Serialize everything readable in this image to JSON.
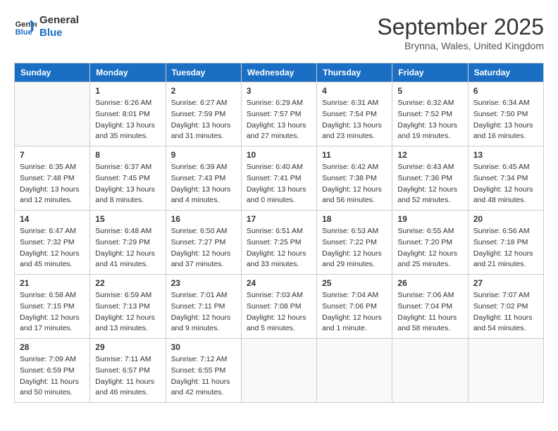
{
  "header": {
    "logo_line1": "General",
    "logo_line2": "Blue",
    "month": "September 2025",
    "location": "Brynna, Wales, United Kingdom"
  },
  "days_of_week": [
    "Sunday",
    "Monday",
    "Tuesday",
    "Wednesday",
    "Thursday",
    "Friday",
    "Saturday"
  ],
  "weeks": [
    [
      {
        "day": "",
        "info": ""
      },
      {
        "day": "1",
        "info": "Sunrise: 6:26 AM\nSunset: 8:01 PM\nDaylight: 13 hours\nand 35 minutes."
      },
      {
        "day": "2",
        "info": "Sunrise: 6:27 AM\nSunset: 7:59 PM\nDaylight: 13 hours\nand 31 minutes."
      },
      {
        "day": "3",
        "info": "Sunrise: 6:29 AM\nSunset: 7:57 PM\nDaylight: 13 hours\nand 27 minutes."
      },
      {
        "day": "4",
        "info": "Sunrise: 6:31 AM\nSunset: 7:54 PM\nDaylight: 13 hours\nand 23 minutes."
      },
      {
        "day": "5",
        "info": "Sunrise: 6:32 AM\nSunset: 7:52 PM\nDaylight: 13 hours\nand 19 minutes."
      },
      {
        "day": "6",
        "info": "Sunrise: 6:34 AM\nSunset: 7:50 PM\nDaylight: 13 hours\nand 16 minutes."
      }
    ],
    [
      {
        "day": "7",
        "info": "Sunrise: 6:35 AM\nSunset: 7:48 PM\nDaylight: 13 hours\nand 12 minutes."
      },
      {
        "day": "8",
        "info": "Sunrise: 6:37 AM\nSunset: 7:45 PM\nDaylight: 13 hours\nand 8 minutes."
      },
      {
        "day": "9",
        "info": "Sunrise: 6:39 AM\nSunset: 7:43 PM\nDaylight: 13 hours\nand 4 minutes."
      },
      {
        "day": "10",
        "info": "Sunrise: 6:40 AM\nSunset: 7:41 PM\nDaylight: 13 hours\nand 0 minutes."
      },
      {
        "day": "11",
        "info": "Sunrise: 6:42 AM\nSunset: 7:38 PM\nDaylight: 12 hours\nand 56 minutes."
      },
      {
        "day": "12",
        "info": "Sunrise: 6:43 AM\nSunset: 7:36 PM\nDaylight: 12 hours\nand 52 minutes."
      },
      {
        "day": "13",
        "info": "Sunrise: 6:45 AM\nSunset: 7:34 PM\nDaylight: 12 hours\nand 48 minutes."
      }
    ],
    [
      {
        "day": "14",
        "info": "Sunrise: 6:47 AM\nSunset: 7:32 PM\nDaylight: 12 hours\nand 45 minutes."
      },
      {
        "day": "15",
        "info": "Sunrise: 6:48 AM\nSunset: 7:29 PM\nDaylight: 12 hours\nand 41 minutes."
      },
      {
        "day": "16",
        "info": "Sunrise: 6:50 AM\nSunset: 7:27 PM\nDaylight: 12 hours\nand 37 minutes."
      },
      {
        "day": "17",
        "info": "Sunrise: 6:51 AM\nSunset: 7:25 PM\nDaylight: 12 hours\nand 33 minutes."
      },
      {
        "day": "18",
        "info": "Sunrise: 6:53 AM\nSunset: 7:22 PM\nDaylight: 12 hours\nand 29 minutes."
      },
      {
        "day": "19",
        "info": "Sunrise: 6:55 AM\nSunset: 7:20 PM\nDaylight: 12 hours\nand 25 minutes."
      },
      {
        "day": "20",
        "info": "Sunrise: 6:56 AM\nSunset: 7:18 PM\nDaylight: 12 hours\nand 21 minutes."
      }
    ],
    [
      {
        "day": "21",
        "info": "Sunrise: 6:58 AM\nSunset: 7:15 PM\nDaylight: 12 hours\nand 17 minutes."
      },
      {
        "day": "22",
        "info": "Sunrise: 6:59 AM\nSunset: 7:13 PM\nDaylight: 12 hours\nand 13 minutes."
      },
      {
        "day": "23",
        "info": "Sunrise: 7:01 AM\nSunset: 7:11 PM\nDaylight: 12 hours\nand 9 minutes."
      },
      {
        "day": "24",
        "info": "Sunrise: 7:03 AM\nSunset: 7:08 PM\nDaylight: 12 hours\nand 5 minutes."
      },
      {
        "day": "25",
        "info": "Sunrise: 7:04 AM\nSunset: 7:06 PM\nDaylight: 12 hours\nand 1 minute."
      },
      {
        "day": "26",
        "info": "Sunrise: 7:06 AM\nSunset: 7:04 PM\nDaylight: 11 hours\nand 58 minutes."
      },
      {
        "day": "27",
        "info": "Sunrise: 7:07 AM\nSunset: 7:02 PM\nDaylight: 11 hours\nand 54 minutes."
      }
    ],
    [
      {
        "day": "28",
        "info": "Sunrise: 7:09 AM\nSunset: 6:59 PM\nDaylight: 11 hours\nand 50 minutes."
      },
      {
        "day": "29",
        "info": "Sunrise: 7:11 AM\nSunset: 6:57 PM\nDaylight: 11 hours\nand 46 minutes."
      },
      {
        "day": "30",
        "info": "Sunrise: 7:12 AM\nSunset: 6:55 PM\nDaylight: 11 hours\nand 42 minutes."
      },
      {
        "day": "",
        "info": ""
      },
      {
        "day": "",
        "info": ""
      },
      {
        "day": "",
        "info": ""
      },
      {
        "day": "",
        "info": ""
      }
    ]
  ]
}
